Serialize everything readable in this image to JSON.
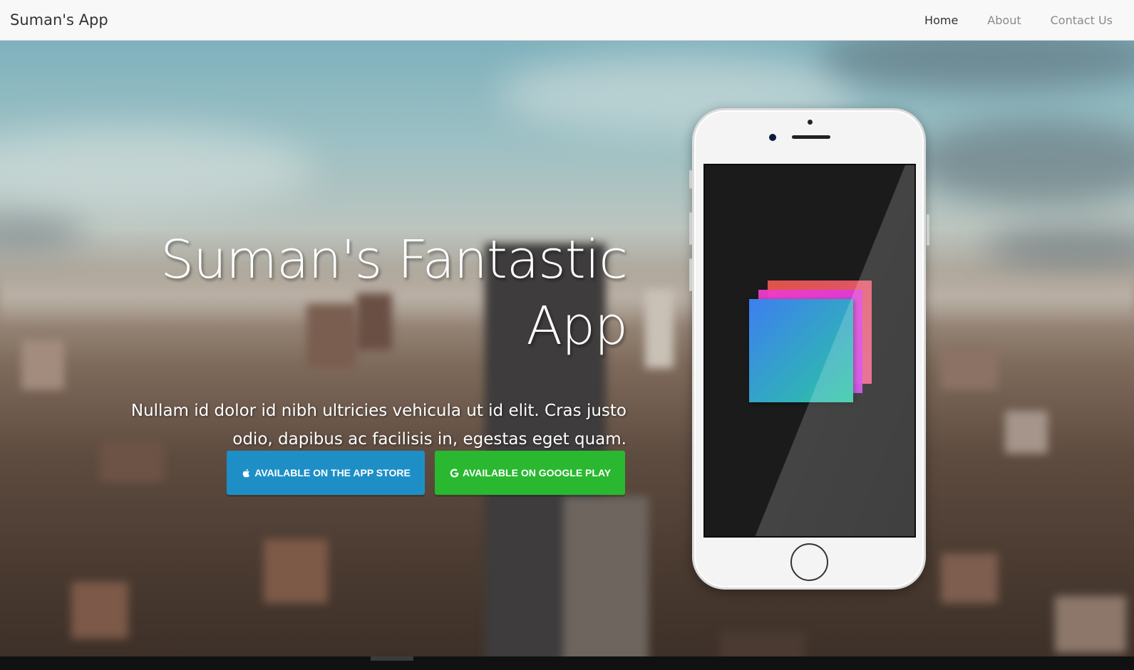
{
  "navbar": {
    "brand": "Suman's App",
    "links": [
      {
        "label": "Home",
        "active": true
      },
      {
        "label": "About",
        "active": false
      },
      {
        "label": "Contact Us",
        "active": false
      }
    ]
  },
  "hero": {
    "title_line1": "Suman's Fantastic",
    "title_line2": "App",
    "subtitle": "Nullam id dolor id nibh ultricies vehicula ut id elit. Cras justo odio, dapibus ac facilisis in, egestas eget quam.",
    "buttons": {
      "app_store": {
        "label": "AVAILABLE ON THE APP STORE",
        "icon": "apple-icon",
        "color": "#1e8fc6"
      },
      "google_play": {
        "label": "AVAILABLE ON GOOGLE PLAY",
        "icon": "google-icon",
        "color": "#29b830"
      }
    }
  },
  "colors": {
    "navbar_bg": "#f8f8f8",
    "brand_text": "#333333",
    "nav_inactive": "#8a8a8a"
  }
}
